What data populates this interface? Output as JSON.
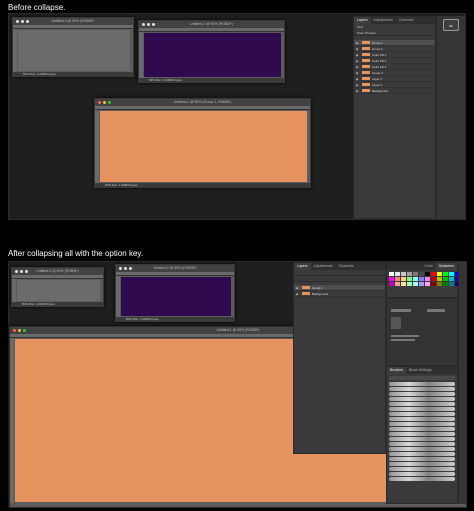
{
  "captions": {
    "before": "Before collapse.",
    "after": "After collapsing all with the option key."
  },
  "colors": {
    "background": "#000000",
    "workspace": "#1f1f1f",
    "grey_canvas": "#6b6b6b",
    "purple_canvas": "#2f0a4e",
    "orange_canvas": "#e7935f",
    "panel": "#3a3a3a",
    "selection": "#4e4e4e"
  },
  "before": {
    "doc_left_title": "Untitled-3 @ 50% (RGB/8*)",
    "doc_right_title": "Untitled-2 @ 50% (RGB/8*)",
    "doc_center_title": "Untitled-1 @ 50% (Group 1, RGB/8*)",
    "status": "50%  Doc: 1.03M/0 bytes",
    "layers_tabs": [
      "Layers",
      "Adjustments",
      "Channels"
    ],
    "layers_kind_label": "Kind",
    "layers_mode": "Pass Through",
    "layers": [
      {
        "name": "Group 1",
        "type": "group",
        "thumb": "#e7935f"
      },
      {
        "name": "Group 2",
        "type": "group",
        "thumb": "#e7935f"
      },
      {
        "name": "Color Fill 1",
        "type": "fill",
        "thumb": "#e7935f"
      },
      {
        "name": "Color Fill 2",
        "type": "fill",
        "thumb": "#e7935f"
      },
      {
        "name": "Color Fill 3",
        "type": "fill",
        "thumb": "#e7935f"
      },
      {
        "name": "Group 3",
        "type": "group",
        "thumb": "#e7935f"
      },
      {
        "name": "Layer 1",
        "type": "layer",
        "thumb": "#e7935f"
      },
      {
        "name": "Layer 2",
        "type": "layer",
        "thumb": "#e7935f"
      },
      {
        "name": "Background",
        "type": "layer",
        "thumb": "#e7935f"
      }
    ],
    "collapse_icon": "chevron-down-icon"
  },
  "after": {
    "doc_left_title": "Untitled-3 @ 50% (RGB/8*)",
    "doc_right_title": "Untitled-2 @ 50% (RGB/8*)",
    "doc_big_title": "Untitled-1 @ 50% (RGB/8*)",
    "status": "50%  Doc: 1.03M/0 bytes",
    "layers_tabs": [
      "Layers",
      "Adjustments",
      "Channels"
    ],
    "swatch_tabs": [
      "Color",
      "Swatches"
    ],
    "brush_tabs": [
      "Brushes",
      "Brush Settings"
    ],
    "layers": [
      {
        "name": "Group 1",
        "thumb": "#e7935f"
      },
      {
        "name": "Background",
        "thumb": "#e7935f"
      }
    ]
  }
}
